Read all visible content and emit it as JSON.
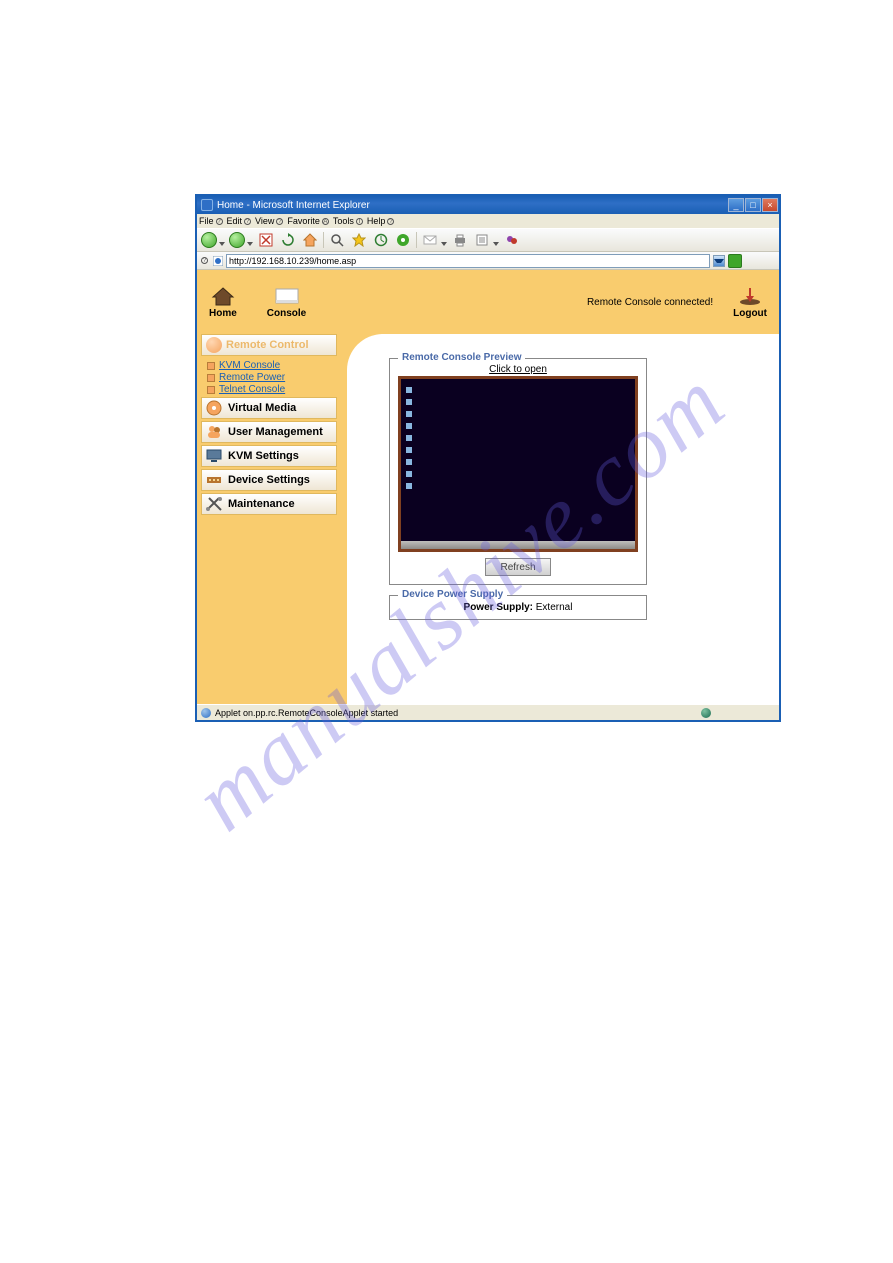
{
  "window": {
    "title": "Home - Microsoft Internet Explorer"
  },
  "menu": {
    "file": "File",
    "edit": "Edit",
    "view": "View",
    "favorite": "Favorite",
    "tools": "Tools",
    "help": "Help"
  },
  "address": {
    "url": "http://192.168.10.239/home.asp"
  },
  "topnav": {
    "home": "Home",
    "console": "Console",
    "status": "Remote Console connected!",
    "logout": "Logout"
  },
  "sidebar": {
    "remote_control": "Remote Control",
    "kvm_console": "KVM Console",
    "remote_power": "Remote Power",
    "telnet_console": "Telnet Console",
    "virtual_media": "Virtual Media",
    "user_management": "User Management",
    "kvm_settings": "KVM Settings",
    "device_settings": "Device Settings",
    "maintenance": "Maintenance"
  },
  "main": {
    "rcp_legend": "Remote Console Preview",
    "click_to_open": "Click to open",
    "refresh": "Refresh",
    "dps_legend": "Device Power Supply",
    "power_supply_label": "Power Supply:",
    "power_supply_value": "External"
  },
  "statusbar": {
    "text": "Applet on.pp.rc.RemoteConsoleApplet started"
  },
  "watermark": "manualshive.com"
}
